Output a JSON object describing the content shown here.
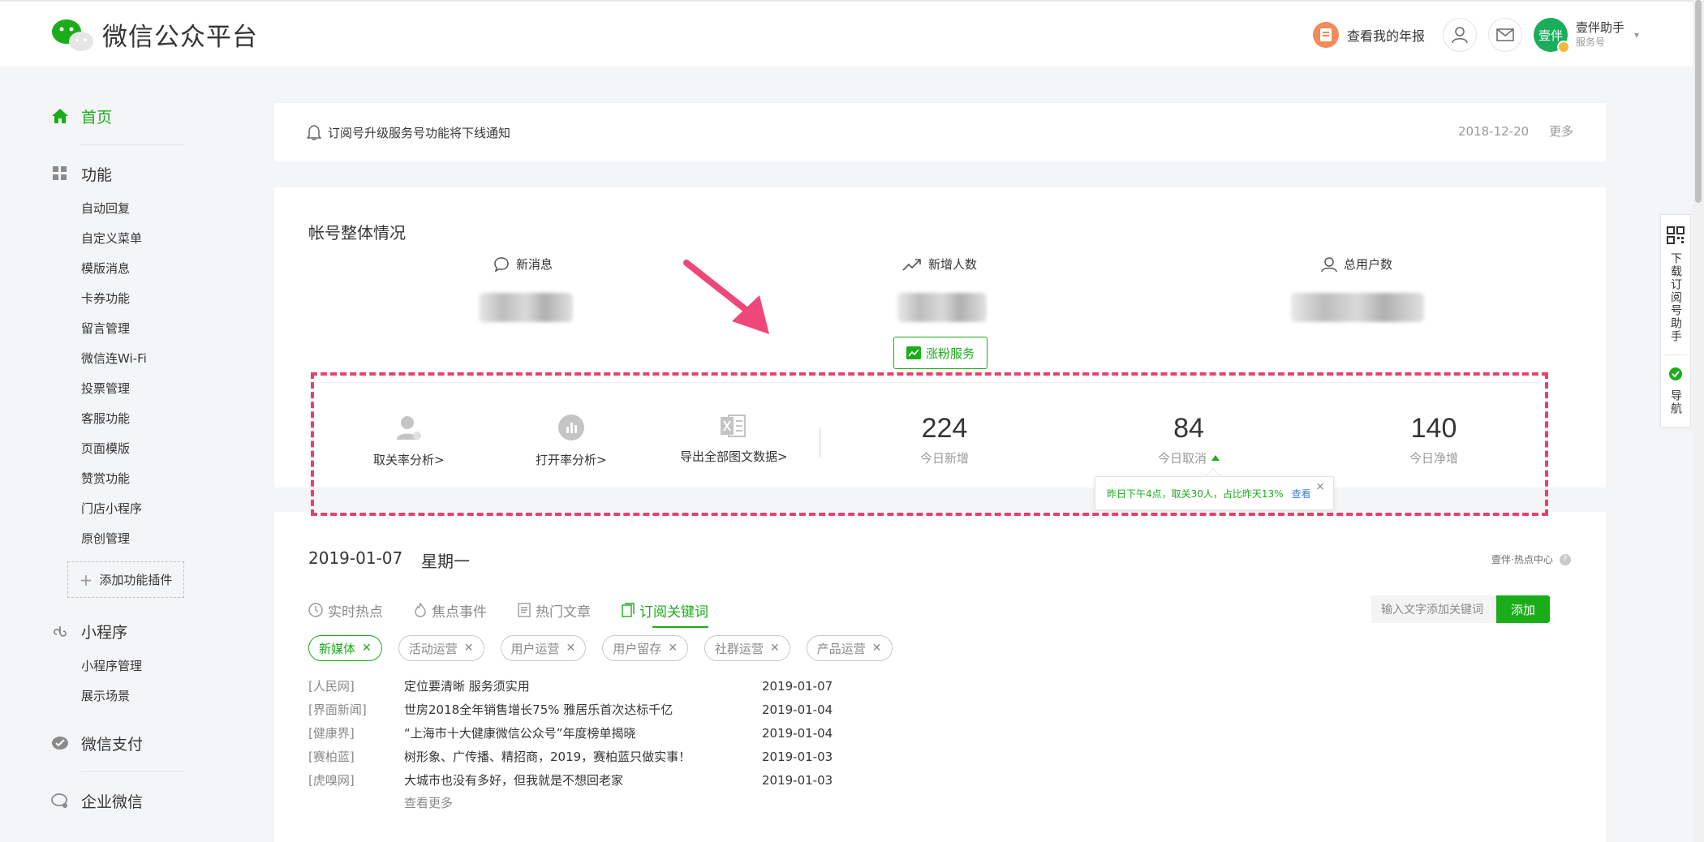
{
  "header": {
    "app_title": "微信公众平台",
    "report_label": "查看我的年报",
    "account_name": "壹伴助手",
    "account_type": "服务号",
    "avatar_text": "壹伴"
  },
  "sidebar": {
    "home": "首页",
    "features": "功能",
    "feature_items": [
      "自动回复",
      "自定义菜单",
      "模版消息",
      "卡券功能",
      "留言管理",
      "微信连Wi-Fi",
      "投票管理",
      "客服功能",
      "页面模版",
      "赞赏功能",
      "门店小程序",
      "原创管理"
    ],
    "add_plugin": "添加功能插件",
    "miniprogram": "小程序",
    "miniprogram_items": [
      "小程序管理",
      "展示场景"
    ],
    "wechat_pay": "微信支付",
    "work_wechat": "企业微信"
  },
  "notice": {
    "text": "订阅号升级服务号功能将下线通知",
    "date": "2018-12-20",
    "more": "更多"
  },
  "overview": {
    "title": "帐号整体情况",
    "metric_messages": "新消息",
    "metric_new_users": "新增人数",
    "metric_total_users": "总用户数",
    "fans_service": "涨粉服务",
    "tools": [
      "取关率分析>",
      "打开率分析>",
      "导出全部图文数据>"
    ],
    "stats": [
      {
        "value": "224",
        "label": "今日新增"
      },
      {
        "value": "84",
        "label": "今日取消"
      },
      {
        "value": "140",
        "label": "今日净增"
      }
    ],
    "tooltip_text": "昨日下午4点，取关30人，占比昨天13%",
    "tooltip_link": "查看",
    "tooltip_close": "×"
  },
  "hot": {
    "date": "2019-01-07",
    "weekday": "星期一",
    "center_label": "壹伴·热点中心",
    "tabs": [
      "实时热点",
      "焦点事件",
      "热门文章",
      "订阅关键词"
    ],
    "active_tab": 3,
    "keyword_placeholder": "输入文字添加关键词",
    "add_label": "添加",
    "chips": [
      "新媒体",
      "活动运营",
      "用户运营",
      "用户留存",
      "社群运营",
      "产品运营"
    ],
    "news": [
      {
        "source": "[人民网]",
        "title": "定位要清晰 服务须实用",
        "date": "2019-01-07"
      },
      {
        "source": "[界面新闻]",
        "title": "世房2018全年销售增长75% 雅居乐首次达标千亿",
        "date": "2019-01-04"
      },
      {
        "source": "[健康界]",
        "title": "“上海市十大健康微信公众号”年度榜单揭晓",
        "date": "2019-01-04"
      },
      {
        "source": "[赛柏蓝]",
        "title": "树形象、广传播、精招商，2019，赛柏蓝只做实事！",
        "date": "2019-01-03"
      },
      {
        "source": "[虎嗅网]",
        "title": "大城市也没有多好，但我就是不想回老家",
        "date": "2019-01-03"
      }
    ],
    "more": "查看更多"
  },
  "float_panel": {
    "download": "下载订阅号助手",
    "nav": "导航"
  },
  "colors": {
    "accent": "#1aad19",
    "highlight": "#e8416d",
    "link": "#3e7fd6"
  }
}
